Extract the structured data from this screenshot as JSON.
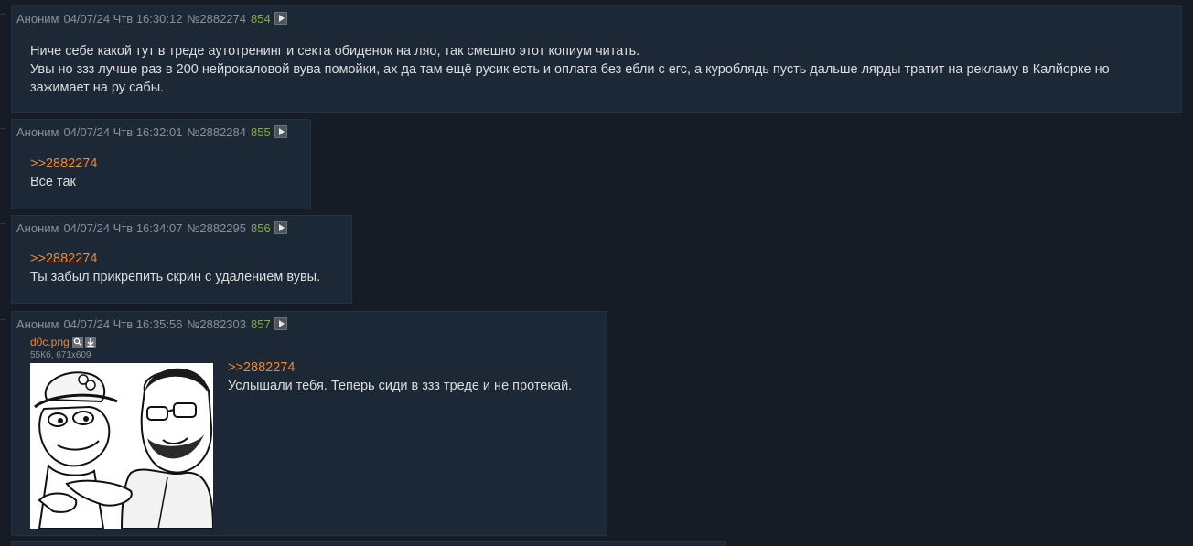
{
  "posts": [
    {
      "name": "Аноним",
      "date": "04/07/24 Чтв 16:30:12",
      "num": "№2882274",
      "count": "854",
      "lines": [
        "Ниче себе какой тут в треде аутотренинг и секта обиденок на ляо, так смешно этот копиум читать.",
        "Увы но ззз лучше раз в 200 нейрокаловой вува помойки, ах да там ещё русик есть и оплата без ебли с егс, а куроблядь пусть дальше лярды тратит на рекламу в Калйорке но",
        "зажимает на ру сабы."
      ]
    },
    {
      "name": "Аноним",
      "date": "04/07/24 Чтв 16:32:01",
      "num": "№2882284",
      "count": "855",
      "reply": ">>2882274",
      "lines": [
        "Все так"
      ]
    },
    {
      "name": "Аноним",
      "date": "04/07/24 Чтв 16:34:07",
      "num": "№2882295",
      "count": "856",
      "reply": ">>2882274",
      "lines": [
        "Ты забыл прикрепить скрин с удалением вувы."
      ]
    },
    {
      "name": "Аноним",
      "date": "04/07/24 Чтв 16:35:56",
      "num": "№2882303",
      "count": "857",
      "file": {
        "name": "d0c.png",
        "meta": "55Кб, 671x609",
        "search_icon": "magnifier-icon",
        "download_icon": "download-icon"
      },
      "reply": ">>2882274",
      "lines": [
        "Услышали тебя. Теперь сиди в ззз треде и не протекай."
      ]
    }
  ],
  "colors": {
    "page_bg": "#151c26",
    "post_bg": "#1c2836",
    "post_border": "#263241",
    "meta_text": "#8a8f96",
    "count": "#89a94a",
    "reply_link": "#f0862f",
    "body_text": "#dcdcdc"
  }
}
